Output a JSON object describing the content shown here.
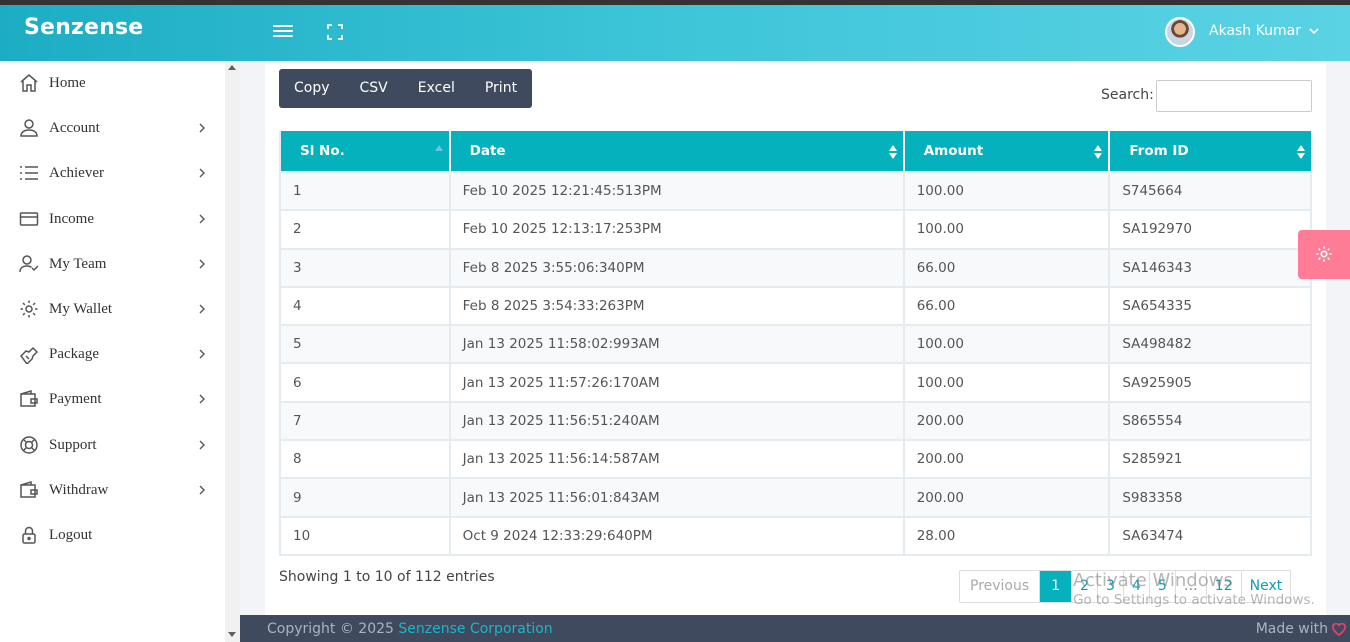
{
  "header": {
    "brand": "Senzense",
    "user_name": "Akash Kumar"
  },
  "sidebar": {
    "items": [
      {
        "label": "Home",
        "icon": "home-icon"
      },
      {
        "label": "Account",
        "icon": "user-icon"
      },
      {
        "label": "Achiever",
        "icon": "list-icon"
      },
      {
        "label": "Income",
        "icon": "card-icon"
      },
      {
        "label": "My Team",
        "icon": "team-icon"
      },
      {
        "label": "My Wallet",
        "icon": "gear-icon"
      },
      {
        "label": "Package",
        "icon": "package-icon"
      },
      {
        "label": "Payment",
        "icon": "wallet-icon"
      },
      {
        "label": "Support",
        "icon": "support-icon"
      },
      {
        "label": "Withdraw",
        "icon": "withdraw-icon"
      },
      {
        "label": "Logout",
        "icon": "lock-icon"
      }
    ]
  },
  "toolbar": {
    "copy": "Copy",
    "csv": "CSV",
    "excel": "Excel",
    "print": "Print",
    "search_label": "Search:"
  },
  "table": {
    "columns": [
      "Sl No.",
      "Date",
      "Amount",
      "From ID"
    ],
    "rows": [
      [
        "1",
        "Feb 10 2025 12:21:45:513PM",
        "100.00",
        "S745664"
      ],
      [
        "2",
        "Feb 10 2025 12:13:17:253PM",
        "100.00",
        "SA192970"
      ],
      [
        "3",
        "Feb 8 2025 3:55:06:340PM",
        "66.00",
        "SA146343"
      ],
      [
        "4",
        "Feb 8 2025 3:54:33:263PM",
        "66.00",
        "SA654335"
      ],
      [
        "5",
        "Jan 13 2025 11:58:02:993AM",
        "100.00",
        "SA498482"
      ],
      [
        "6",
        "Jan 13 2025 11:57:26:170AM",
        "100.00",
        "SA925905"
      ],
      [
        "7",
        "Jan 13 2025 11:56:51:240AM",
        "200.00",
        "S865554"
      ],
      [
        "8",
        "Jan 13 2025 11:56:14:587AM",
        "200.00",
        "S285921"
      ],
      [
        "9",
        "Jan 13 2025 11:56:01:843AM",
        "200.00",
        "S983358"
      ],
      [
        "10",
        "Oct 9 2024 12:33:29:640PM",
        "28.00",
        "SA63474"
      ]
    ]
  },
  "info": "Showing 1 to 10 of 112 entries",
  "pagination": {
    "previous": "Previous",
    "pages": [
      "1",
      "2",
      "3",
      "4",
      "5",
      "…",
      "12"
    ],
    "next": "Next",
    "current": "1"
  },
  "watermark": {
    "line1": "Activate Windows",
    "line2": "Go to Settings to activate Windows."
  },
  "footer": {
    "copyright": "Copyright © 2025 ",
    "company": "Senzense Corporation",
    "made_with": "Made with"
  },
  "colors": {
    "header_gradient_start": "#1cadc4",
    "table_header": "#04b1bd",
    "button_group": "#3f4a5e",
    "settings_tab": "#fe7c96",
    "footer": "#3f4a5e"
  }
}
